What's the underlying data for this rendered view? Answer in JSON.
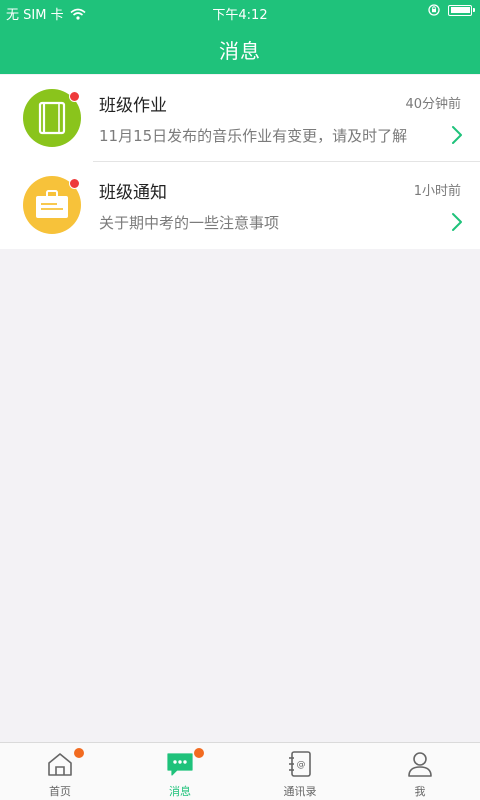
{
  "statusbar": {
    "carrier": "无 SIM 卡",
    "time": "下午4:12"
  },
  "navbar": {
    "title": "消息"
  },
  "messages": [
    {
      "name": "班级作业",
      "time": "40分钟前",
      "desc": "11月15日发布的音乐作业有变更，请及时了解",
      "icon": "notebook-icon",
      "icon_color": "#8ac41c",
      "unread": true
    },
    {
      "name": "班级通知",
      "time": "1小时前",
      "desc": "关于期中考的一些注意事项",
      "icon": "clipboard-icon",
      "icon_color": "#f7c23a",
      "unread": true
    }
  ],
  "tabbar": {
    "items": [
      {
        "label": "首页",
        "icon": "home-icon",
        "active": false,
        "badge": true
      },
      {
        "label": "消息",
        "icon": "chat-icon",
        "active": true,
        "badge": true
      },
      {
        "label": "通讯录",
        "icon": "contacts-icon",
        "active": false,
        "badge": false
      },
      {
        "label": "我",
        "icon": "user-icon",
        "active": false,
        "badge": false
      }
    ]
  },
  "colors": {
    "primary": "#1fc27b",
    "badge": "#f26b20",
    "unread_dot": "#ee3b3b"
  }
}
